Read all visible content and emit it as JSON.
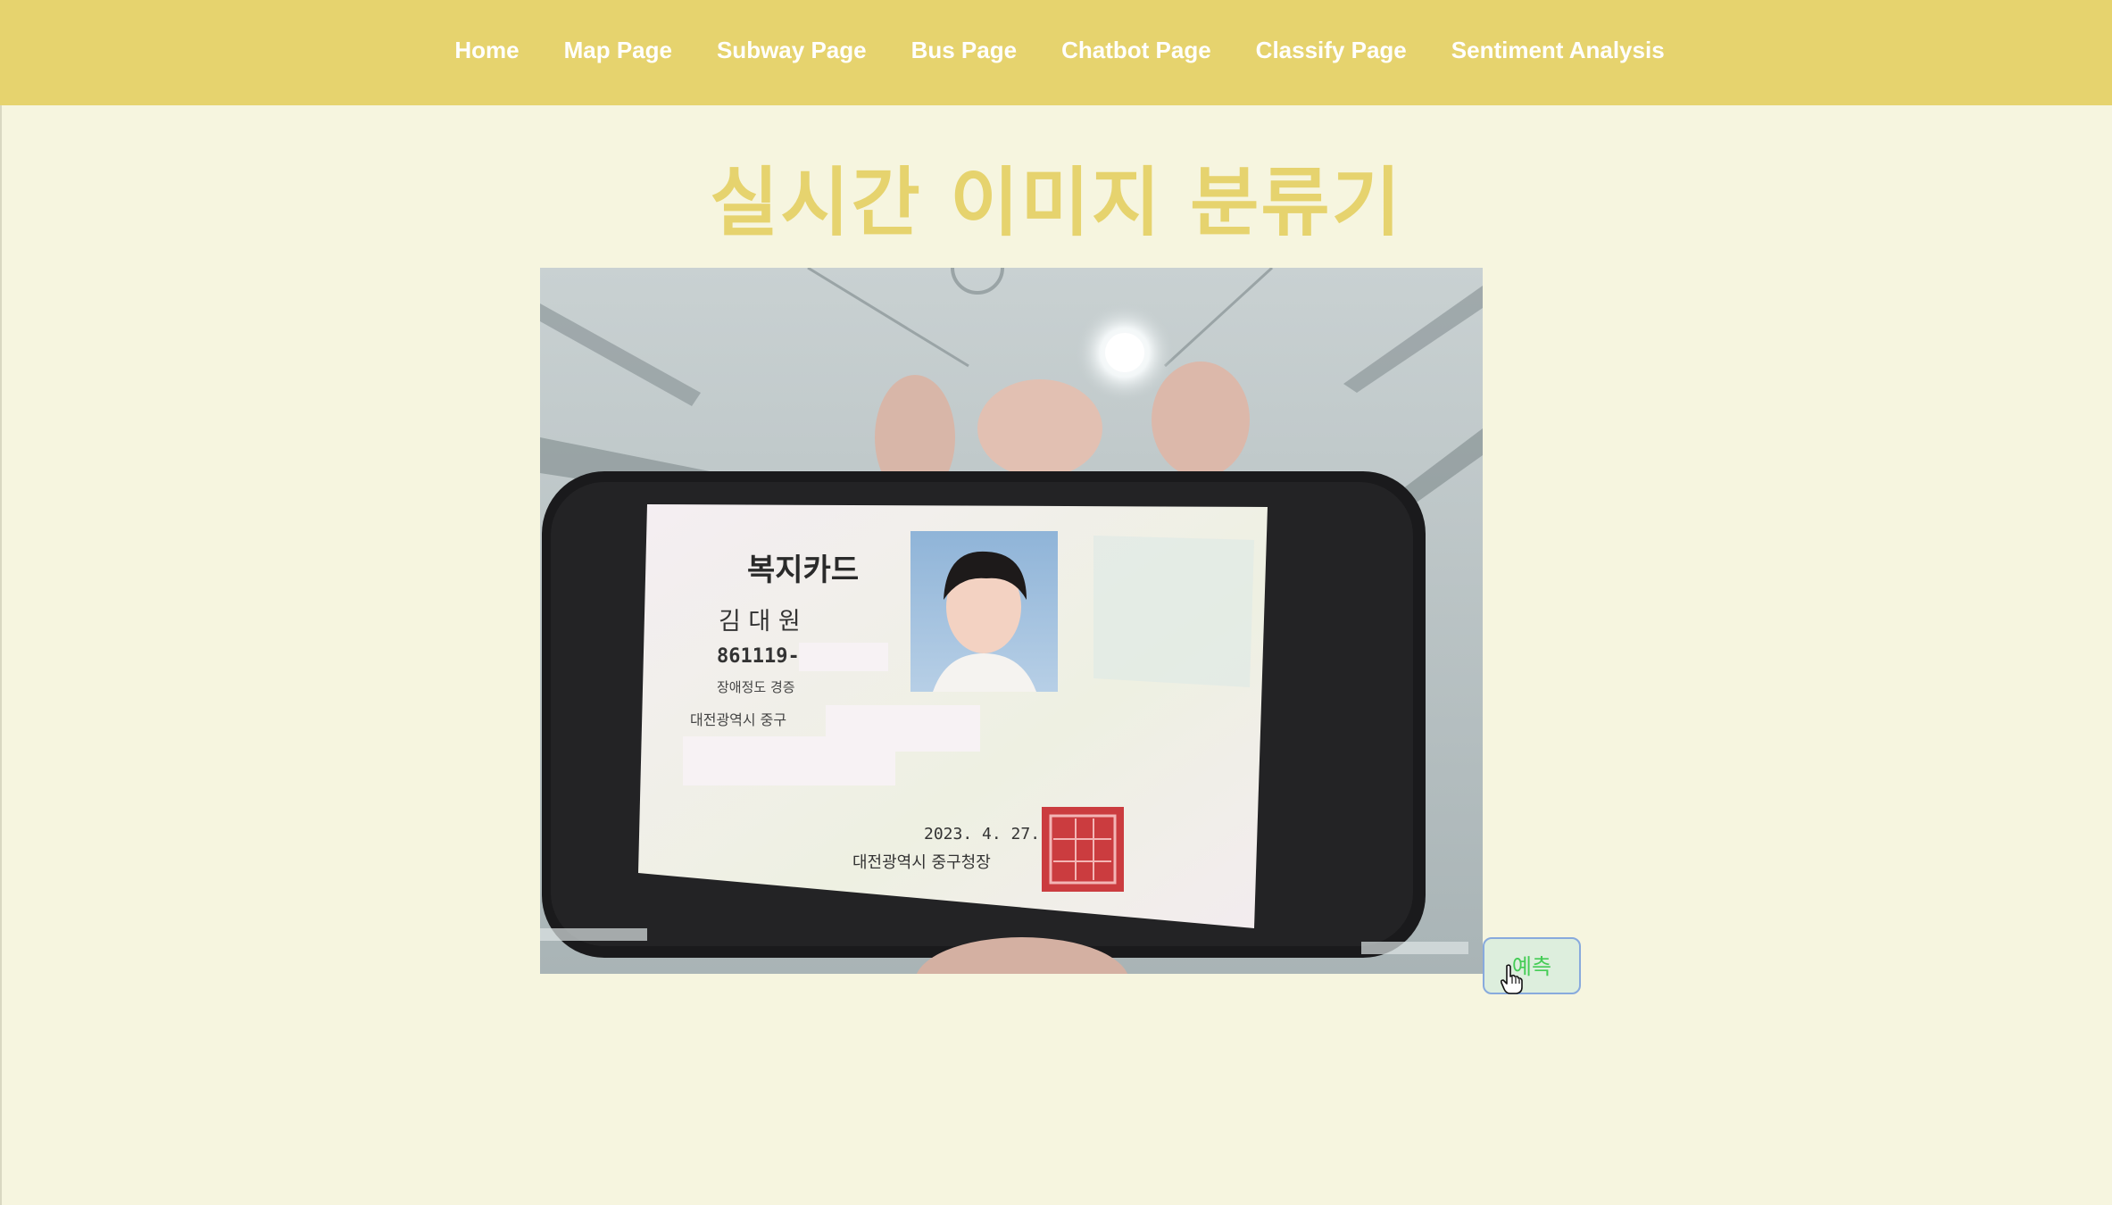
{
  "nav": {
    "items": [
      {
        "label": "Home"
      },
      {
        "label": "Map Page"
      },
      {
        "label": "Subway Page"
      },
      {
        "label": "Bus Page"
      },
      {
        "label": "Chatbot Page"
      },
      {
        "label": "Classify Page"
      },
      {
        "label": "Sentiment Analysis"
      }
    ]
  },
  "page": {
    "title": "실시간 이미지 분류기"
  },
  "webcam": {
    "card": {
      "title": "복지카드",
      "name": "김 대 원",
      "id_number": "861119-",
      "grade": "장애정도 경증",
      "address": "대전광역시 중구",
      "date": "2023. 4. 27.",
      "issuer": "대전광역시 중구청장"
    }
  },
  "predict_button": {
    "label": "예측"
  },
  "colors": {
    "navbar": "#e6d36e",
    "background": "#f6f5df",
    "title": "#e6d36e",
    "button_text": "#44cc55",
    "button_border": "#88aadd"
  },
  "icons": {
    "cursor": "hand-pointer-icon"
  }
}
